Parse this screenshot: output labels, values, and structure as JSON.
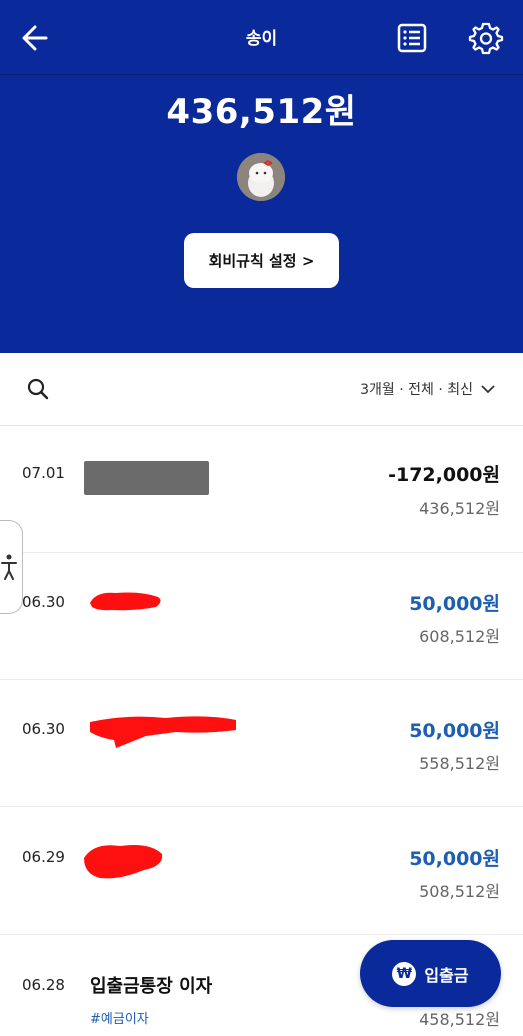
{
  "header": {
    "title": "송이",
    "balance": "436,512원",
    "rule_button_label": "회비규칙 설정 >"
  },
  "filter": {
    "label": "3개월 · 전체 · 최신"
  },
  "transactions": [
    {
      "date": "07.01",
      "amount": "-172,000원",
      "balance": "436,512원",
      "type": "withdrawal"
    },
    {
      "date": "06.30",
      "amount": "50,000원",
      "balance": "608,512원",
      "type": "deposit"
    },
    {
      "date": "06.30",
      "amount": "50,000원",
      "balance": "558,512원",
      "type": "deposit"
    },
    {
      "date": "06.29",
      "amount": "50,000원",
      "balance": "508,512원",
      "type": "deposit"
    },
    {
      "date": "06.28",
      "name": "입출금통장 이자",
      "tag": "#예금이자",
      "balance": "458,512원",
      "type": "interest"
    }
  ],
  "fab": {
    "label": "입출금",
    "icon_glyph": "₩"
  },
  "colors": {
    "primary": "#0a2a9c",
    "deposit": "#1b5fb0"
  }
}
